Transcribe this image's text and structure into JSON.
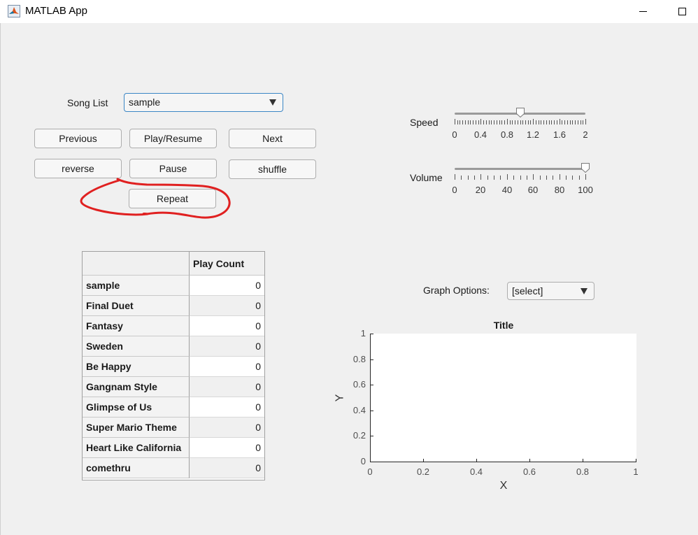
{
  "window": {
    "title": "MATLAB App"
  },
  "song_list": {
    "label": "Song List",
    "selected": "sample"
  },
  "buttons": {
    "previous": "Previous",
    "play_resume": "Play/Resume",
    "next": "Next",
    "reverse": "reverse",
    "pause": "Pause",
    "shuffle": "shuffle",
    "repeat": "Repeat"
  },
  "speed": {
    "label": "Speed",
    "min": 0,
    "max": 2,
    "value": 1,
    "major_ticks": [
      "0",
      "0.4",
      "0.8",
      "1.2",
      "1.6",
      "2"
    ]
  },
  "volume": {
    "label": "Volume",
    "min": 0,
    "max": 100,
    "value": 100,
    "major_ticks": [
      "0",
      "20",
      "40",
      "60",
      "80",
      "100"
    ]
  },
  "table": {
    "columns": [
      "",
      "Play Count"
    ],
    "rows": [
      {
        "name": "sample",
        "count": "0"
      },
      {
        "name": "Final Duet",
        "count": "0"
      },
      {
        "name": "Fantasy",
        "count": "0"
      },
      {
        "name": "Sweden",
        "count": "0"
      },
      {
        "name": "Be Happy",
        "count": "0"
      },
      {
        "name": "Gangnam Style",
        "count": "0"
      },
      {
        "name": "Glimpse of Us",
        "count": "0"
      },
      {
        "name": "Super Mario Theme",
        "count": "0"
      },
      {
        "name": "Heart Like California",
        "count": "0"
      },
      {
        "name": "comethru",
        "count": "0"
      }
    ]
  },
  "graph_options": {
    "label": "Graph Options:",
    "selected": "[select]"
  },
  "chart_data": {
    "type": "line",
    "title": "Title",
    "xlabel": "X",
    "ylabel": "Y",
    "xlim": [
      0,
      1
    ],
    "ylim": [
      0,
      1
    ],
    "x_ticks": [
      "0",
      "0.2",
      "0.4",
      "0.6",
      "0.8",
      "1"
    ],
    "y_ticks": [
      "0",
      "0.2",
      "0.4",
      "0.6",
      "0.8",
      "1"
    ],
    "series": []
  },
  "annotation": {
    "color": "#e02020"
  },
  "colors": {
    "background": "#f0f0f0",
    "accent": "#3b86c5"
  }
}
